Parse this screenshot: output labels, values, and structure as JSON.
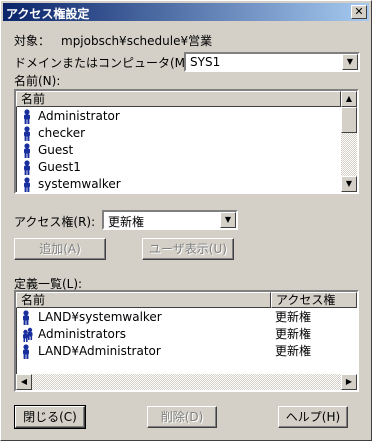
{
  "window": {
    "title": "アクセス権設定",
    "close_glyph": "✕"
  },
  "target": {
    "label": "対象：",
    "value": "mpjobsch¥schedule¥営業"
  },
  "domain": {
    "label": "ドメインまたはコンピュータ(M):",
    "value": "SYS1"
  },
  "names": {
    "label": "名前(N):",
    "header": "名前",
    "items": [
      "Administrator",
      "checker",
      "Guest",
      "Guest1",
      "systemwalker"
    ]
  },
  "access": {
    "label": "アクセス権(R):",
    "value": "更新権"
  },
  "buttons": {
    "add": "追加(A)",
    "show_users": "ユーザ表示(U)",
    "close": "閉じる(C)",
    "delete": "削除(D)",
    "help": "ヘルプ(H)"
  },
  "definitions": {
    "label": "定義一覧(L):",
    "col_name": "名前",
    "col_access": "アクセス権",
    "rows": [
      {
        "name": "LAND¥systemwalker",
        "access": "更新権",
        "icon": "user-icon"
      },
      {
        "name": "Administrators",
        "access": "更新権",
        "icon": "group-icon"
      },
      {
        "name": "LAND¥Administrator",
        "access": "更新権",
        "icon": "user-icon"
      }
    ]
  },
  "colors": {
    "titlebar_start": "#0a246a",
    "titlebar_end": "#a6caf0",
    "icon": "#1a2f9e",
    "face": "#d4d0c8"
  }
}
